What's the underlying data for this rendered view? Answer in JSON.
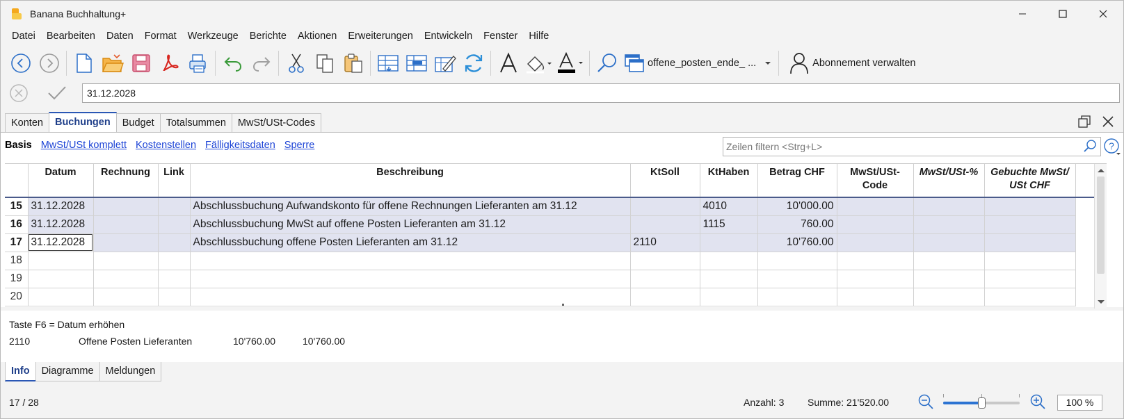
{
  "app": {
    "title": "Banana Buchhaltung+"
  },
  "menu": [
    "Datei",
    "Bearbeiten",
    "Daten",
    "Format",
    "Werkzeuge",
    "Berichte",
    "Aktionen",
    "Erweiterungen",
    "Entwickeln",
    "Fenster",
    "Hilfe"
  ],
  "toolbar": {
    "document_name": "offene_posten_ende_ ...",
    "subscription_label": "Abonnement verwalten"
  },
  "editline": {
    "value": "31.12.2028"
  },
  "tabs": [
    "Konten",
    "Buchungen",
    "Budget",
    "Totalsummen",
    "MwSt/USt-Codes"
  ],
  "views": [
    "Basis",
    "MwSt/USt komplett",
    "Kostenstellen",
    "Fälligkeitsdaten",
    "Sperre"
  ],
  "filter": {
    "placeholder": "Zeilen filtern <Strg+L>"
  },
  "table": {
    "headers": {
      "datum": "Datum",
      "rechnung": "Rechnung",
      "link": "Link",
      "beschreibung": "Beschreibung",
      "ktsoll": "KtSoll",
      "kthaben": "KtHaben",
      "betrag": "Betrag CHF",
      "mwst_code_1": "MwSt/USt-",
      "mwst_code_2": "Code",
      "mwst_pct": "MwSt/USt-%",
      "gebucht_1": "Gebuchte MwSt/",
      "gebucht_2": "USt CHF"
    },
    "rows": [
      {
        "nr": "15",
        "datum": "31.12.2028",
        "beschreibung": "Abschlussbuchung Aufwandskonto für offene Rechnungen Lieferanten am 31.12",
        "ktsoll": "",
        "kthaben": "4010",
        "betrag": "10'000.00"
      },
      {
        "nr": "16",
        "datum": "31.12.2028",
        "beschreibung": "Abschlussbuchung MwSt auf offene Posten Lieferanten am 31.12",
        "ktsoll": "",
        "kthaben": "1115",
        "betrag": "760.00"
      },
      {
        "nr": "17",
        "datum": "31.12.2028",
        "beschreibung": "Abschlussbuchung offene Posten Lieferanten am 31.12",
        "ktsoll": "2110",
        "kthaben": "",
        "betrag": "10'760.00"
      },
      {
        "nr": "18"
      },
      {
        "nr": "19"
      },
      {
        "nr": "20"
      }
    ]
  },
  "info": {
    "hint": "Taste F6 = Datum erhöhen",
    "account": "2110",
    "account_name": "Offene Posten Lieferanten",
    "amount1": "10'760.00",
    "amount2": "10'760.00"
  },
  "bottom_tabs": [
    "Info",
    "Diagramme",
    "Meldungen"
  ],
  "status": {
    "position": "17 / 28",
    "count": "Anzahl: 3",
    "sum": "Summe: 21'520.00",
    "zoom": "100 %",
    "zoom_level_fraction": 0.5
  },
  "colors": {
    "accent": "#2a57b5",
    "row_highlight": "#e1e3f0",
    "link": "#1d44d6"
  }
}
